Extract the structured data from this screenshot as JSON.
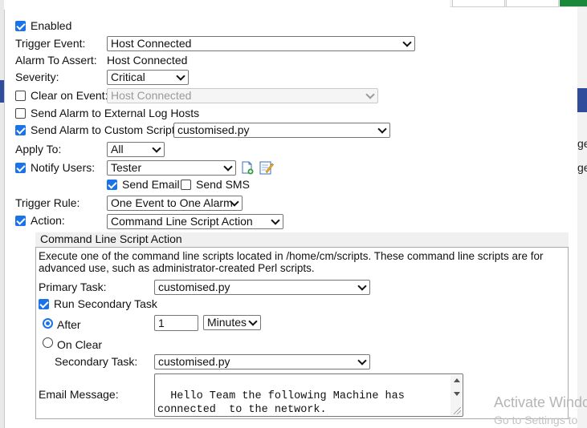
{
  "form": {
    "enabled": {
      "label": "Enabled",
      "checked": true
    },
    "trigger_event": {
      "label": "Trigger Event:",
      "value": "Host Connected"
    },
    "alarm_to_assert": {
      "label": "Alarm To Assert:",
      "value": "Host Connected"
    },
    "severity": {
      "label": "Severity:",
      "value": "Critical"
    },
    "clear_on_event": {
      "label": "Clear on Event:",
      "checked": false,
      "value": "Host Connected"
    },
    "send_external": {
      "label": "Send Alarm to External Log Hosts",
      "checked": false
    },
    "send_custom": {
      "label": "Send Alarm to Custom Script:",
      "checked": true,
      "value": "customised.py"
    },
    "apply_to": {
      "label": "Apply To:",
      "value": "All"
    },
    "notify_users": {
      "label": "Notify Users:",
      "checked": true,
      "value": "Tester"
    },
    "send_email": {
      "label": "Send Email",
      "checked": true
    },
    "send_sms": {
      "label": "Send SMS",
      "checked": false
    },
    "trigger_rule": {
      "label": "Trigger Rule:",
      "value": "One Event to One Alarm"
    },
    "action": {
      "label": "Action:",
      "checked": true,
      "value": "Command Line Script Action"
    }
  },
  "script_section": {
    "title": "Command Line Script Action",
    "description": "Execute one of the command line scripts located in /home/cm/scripts. These command line scripts are for advanced use, such as administrator-created Perl scripts.",
    "primary_task": {
      "label": "Primary Task:",
      "value": "customised.py"
    },
    "run_secondary": {
      "label": "Run Secondary Task",
      "checked": true
    },
    "after": {
      "label": "After",
      "selected": true,
      "amount": "1",
      "unit": "Minutes"
    },
    "on_clear": {
      "label": "On Clear",
      "selected": false
    },
    "secondary_task": {
      "label": "Secondary Task:",
      "value": "customised.py"
    },
    "email_message": {
      "label": "Email Message:",
      "text": "Hello Team the following Machine has\nconnected  to the network.\nMachine Details : Host Connected - Machine:"
    }
  },
  "overlay": {
    "activate_line1": "Activate Windo",
    "activate_line2": "Go to Settings to"
  },
  "background_fragments": {
    "frag1": "ge",
    "frag2": "ge"
  },
  "icons": {
    "add_user": "add-user-icon",
    "edit_user": "edit-user-icon"
  },
  "colors": {
    "accent": "#1a73e8",
    "bg_band": "#2f4d9a"
  }
}
